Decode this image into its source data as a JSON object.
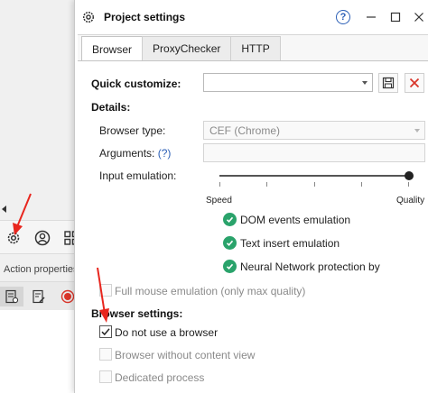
{
  "background": {
    "action_properties_label": "Action properties"
  },
  "dialog": {
    "title": "Project settings",
    "help_label": "?",
    "tabs": [
      {
        "label": "Browser",
        "active": true
      },
      {
        "label": "ProxyChecker",
        "active": false
      },
      {
        "label": "HTTP",
        "active": false
      }
    ],
    "quick_customize": {
      "label": "Quick customize:",
      "value": ""
    },
    "details": {
      "heading": "Details:",
      "browser_type_label": "Browser type:",
      "browser_type_value": "CEF (Chrome)",
      "arguments_label": "Arguments:",
      "arguments_help": "(?)",
      "arguments_value": "",
      "input_emulation_label": "Input emulation:",
      "slider_min_label": "Speed",
      "slider_max_label": "Quality",
      "slider_level": 1.0,
      "emulation_options": [
        "DOM events emulation",
        "Text insert emulation",
        "Neural Network protection bypas"
      ],
      "full_mouse_label": "Full mouse emulation (only max quality)"
    },
    "browser_settings": {
      "heading": "Browser settings:",
      "options": [
        {
          "label": "Do not use a browser",
          "checked": true,
          "enabled": true
        },
        {
          "label": "Browser without content view",
          "checked": false,
          "enabled": false
        },
        {
          "label": "Dedicated process",
          "checked": false,
          "enabled": false
        }
      ]
    }
  },
  "colors": {
    "accent_blue": "#2b5fb6",
    "check_green": "#2aa36b",
    "delete_red": "#d9352a",
    "annotation_red": "#e8261e"
  }
}
